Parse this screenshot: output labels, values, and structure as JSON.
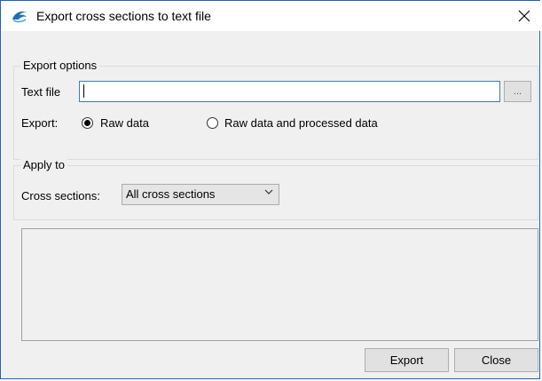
{
  "window": {
    "title": "Export cross sections to text file",
    "close_glyph": "✕"
  },
  "export_options": {
    "legend": "Export options",
    "text_file_label": "Text file",
    "text_file_value": "",
    "browse_label": "...",
    "export_label": "Export:",
    "radio_raw": "Raw data",
    "radio_raw_processed": "Raw data and processed data",
    "selected": "Raw data"
  },
  "apply_to": {
    "legend": "Apply to",
    "cross_sections_label": "Cross sections:",
    "cross_sections_value": "All cross sections"
  },
  "buttons": {
    "export": "Export",
    "close": "Close"
  },
  "icons": {
    "app": "dolphin-app-icon",
    "close": "close-icon",
    "dropdown": "chevron-down-icon"
  }
}
